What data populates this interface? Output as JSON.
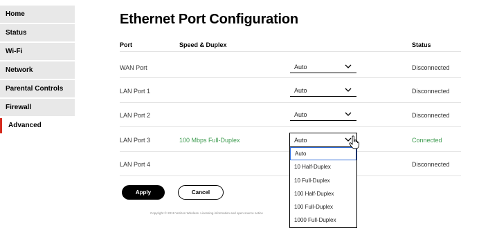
{
  "sidebar": {
    "items": [
      {
        "label": "Home"
      },
      {
        "label": "Status"
      },
      {
        "label": "Wi-Fi"
      },
      {
        "label": "Network"
      },
      {
        "label": "Parental Controls"
      },
      {
        "label": "Firewall"
      },
      {
        "label": "Advanced",
        "active": true
      }
    ]
  },
  "page": {
    "title": "Ethernet Port Configuration"
  },
  "table": {
    "headers": {
      "port": "Port",
      "speed": "Speed & Duplex",
      "status": "Status"
    },
    "rows": [
      {
        "port": "WAN Port",
        "speed": "",
        "select_value": "Auto",
        "status": "Disconnected"
      },
      {
        "port": "LAN Port 1",
        "speed": "",
        "select_value": "Auto",
        "status": "Disconnected"
      },
      {
        "port": "LAN Port 2",
        "speed": "",
        "select_value": "Auto",
        "status": "Disconnected"
      },
      {
        "port": "LAN Port 3",
        "speed": "100 Mbps Full-Duplex",
        "select_value": "Auto",
        "status": "Connected"
      },
      {
        "port": "LAN Port 4",
        "speed": "",
        "select_value": "",
        "status": "Disconnected"
      }
    ]
  },
  "dropdown": {
    "options": [
      "Auto",
      "10 Half-Duplex",
      "10 Full-Duplex",
      "100 Half-Duplex",
      "100 Full-Duplex",
      "1000 Full-Duplex"
    ],
    "selected_option": "Auto"
  },
  "buttons": {
    "apply": "Apply",
    "cancel": "Cancel"
  },
  "footer": {
    "text": "Copyright © 2019 Verizon Wireless. Licensing information and open source notice"
  },
  "colors": {
    "accent": "#d52b1e",
    "connected": "#3d9b4f"
  }
}
